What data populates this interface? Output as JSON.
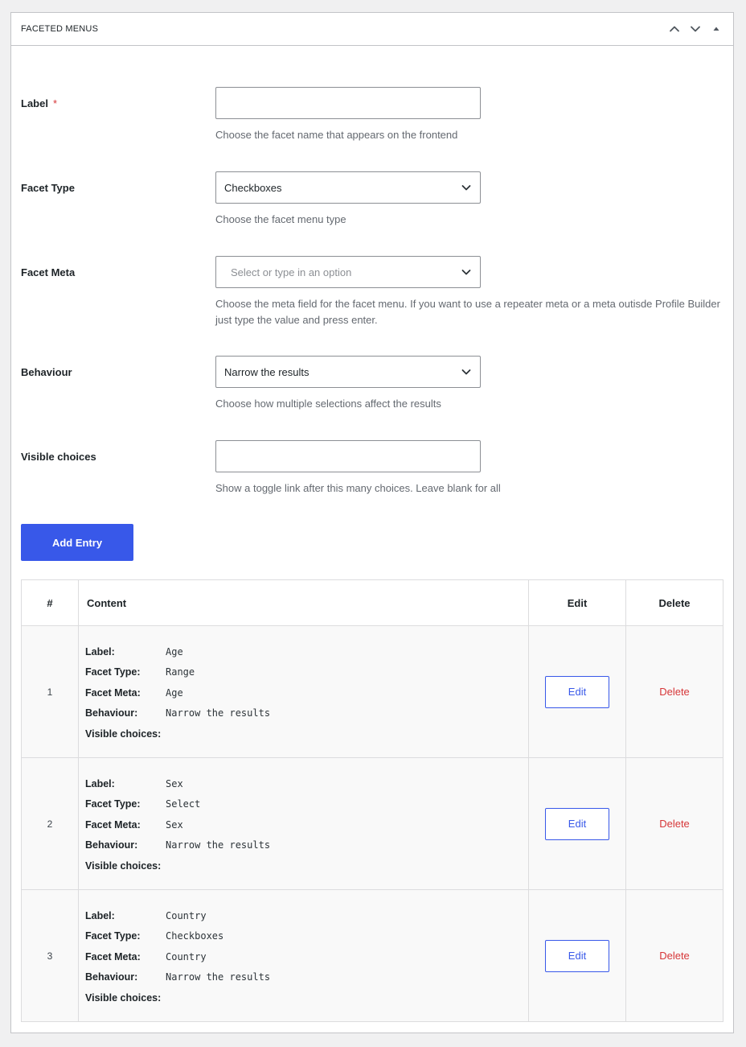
{
  "panel": {
    "title": "FACETED MENUS"
  },
  "form": {
    "label": {
      "label": "Label",
      "required_mark": "*",
      "value": "",
      "help": "Choose the facet name that appears on the frontend"
    },
    "facet_type": {
      "label": "Facet Type",
      "value": "Checkboxes",
      "help": "Choose the facet menu type"
    },
    "facet_meta": {
      "label": "Facet Meta",
      "placeholder": "Select or type in an option",
      "help": "Choose the meta field for the facet menu. If you want to use a repeater meta or a meta outisde Profile Builder just type the value and press enter."
    },
    "behaviour": {
      "label": "Behaviour",
      "value": "Narrow the results",
      "help": "Choose how multiple selections affect the results"
    },
    "visible_choices": {
      "label": "Visible choices",
      "value": "",
      "help": "Show a toggle link after this many choices. Leave blank for all"
    },
    "add_entry_label": "Add Entry"
  },
  "table": {
    "headers": {
      "num": "#",
      "content": "Content",
      "edit": "Edit",
      "delete": "Delete"
    },
    "field_keys": {
      "label": "Label:",
      "facet_type": "Facet Type:",
      "facet_meta": "Facet Meta:",
      "behaviour": "Behaviour:",
      "visible_choices": "Visible choices:"
    },
    "rows": [
      {
        "num": "1",
        "label": "Age",
        "facet_type": "Range",
        "facet_meta": "Age",
        "behaviour": "Narrow the results",
        "visible_choices": "",
        "edit_label": "Edit",
        "delete_label": "Delete"
      },
      {
        "num": "2",
        "label": "Sex",
        "facet_type": "Select",
        "facet_meta": "Sex",
        "behaviour": "Narrow the results",
        "visible_choices": "",
        "edit_label": "Edit",
        "delete_label": "Delete"
      },
      {
        "num": "3",
        "label": "Country",
        "facet_type": "Checkboxes",
        "facet_meta": "Country",
        "behaviour": "Narrow the results",
        "visible_choices": "",
        "edit_label": "Edit",
        "delete_label": "Delete"
      }
    ]
  },
  "colors": {
    "accent": "#3858e9",
    "danger": "#d63638",
    "border": "#c3c4c7",
    "muted_text": "#646970"
  },
  "icons": {
    "move_up": "chevron-up-icon",
    "move_down": "chevron-down-icon",
    "toggle": "caret-up-icon",
    "select_arrow": "chevron-down-icon"
  }
}
